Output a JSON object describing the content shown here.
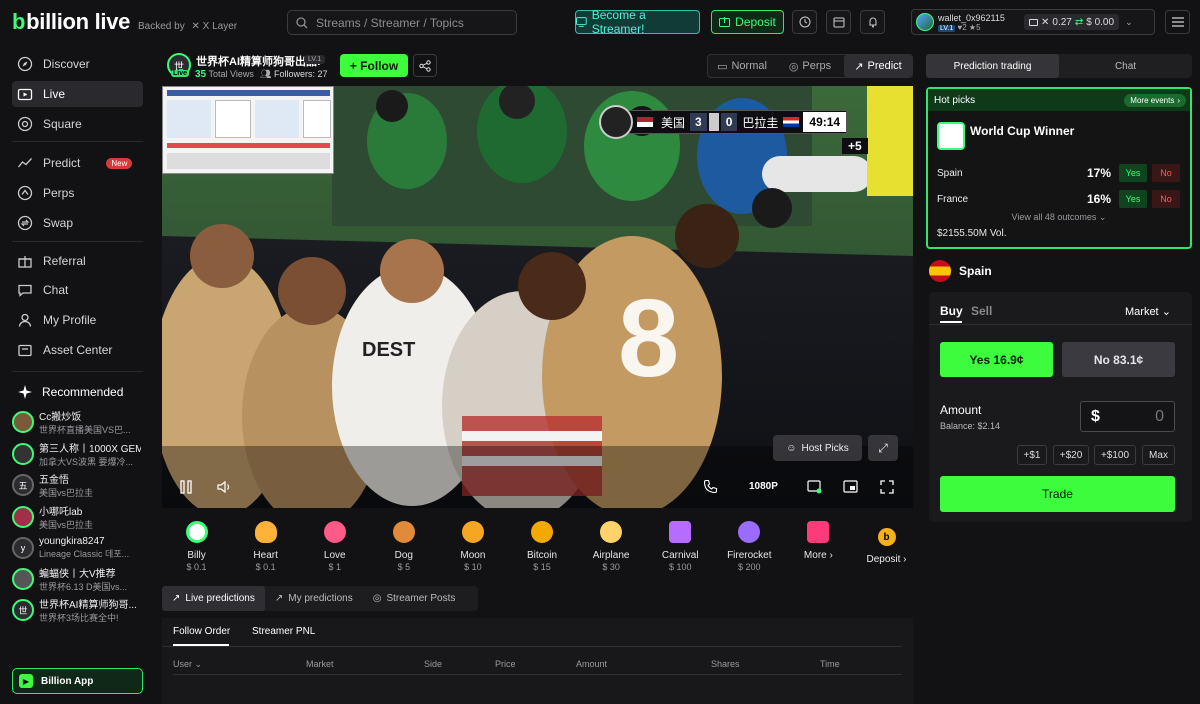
{
  "header": {
    "logo": "billion live",
    "backed_by": "Backed by",
    "backed_partner": "X Layer",
    "search_placeholder": "Streams / Streamer / Topics",
    "become_streamer": "Become a Streamer!",
    "deposit": "Deposit",
    "wallet": {
      "name": "wallet_0x962115",
      "level": "LV.1",
      "stat_a": "2",
      "stat_b": "5",
      "balance_a": "0.27",
      "balance_b": "$ 0.00"
    }
  },
  "sidebar": {
    "nav": [
      {
        "label": "Discover",
        "icon": "compass-icon"
      },
      {
        "label": "Live",
        "icon": "tv-icon"
      },
      {
        "label": "Square",
        "icon": "square-icon"
      },
      {
        "label": "Predict",
        "icon": "predict-icon",
        "badge": "New"
      },
      {
        "label": "Perps",
        "icon": "perps-icon"
      },
      {
        "label": "Swap",
        "icon": "swap-icon"
      },
      {
        "label": "Referral",
        "icon": "gift-icon"
      },
      {
        "label": "Chat",
        "icon": "chat-icon"
      },
      {
        "label": "My Profile",
        "icon": "user-icon"
      },
      {
        "label": "Asset Center",
        "icon": "wallet-icon"
      }
    ],
    "recommended_title": "Recommended",
    "recommended": [
      {
        "avatar": "",
        "name": "Cc搬炒饭",
        "desc": "世界杯直播美国VS巴..."
      },
      {
        "avatar": "",
        "name": "第三人称丨1000X GEM",
        "desc": "加拿大VS波黑 要爆冷..."
      },
      {
        "avatar": "五",
        "name": "五金悟",
        "desc": "美国vs巴拉圭"
      },
      {
        "avatar": "",
        "name": "小哪吒lab",
        "desc": "美国vs巴拉圭"
      },
      {
        "avatar": "y",
        "name": "youngkira8247",
        "desc": "Lineage Classic 데포..."
      },
      {
        "avatar": "",
        "name": "蝙蝠侠丨大V推荐",
        "desc": "世界杯6.13 D美国vs..."
      },
      {
        "avatar": "世",
        "name": "世界杯AI精算师狗哥...",
        "desc": "世界杯3场比赛全中!"
      }
    ],
    "app_button": "Billion App"
  },
  "stream": {
    "avatar": "世",
    "live_badge": "Live",
    "title": "世界杯AI精算师狗哥出品!",
    "level": "LV.1",
    "views_count": "35",
    "views_label": "Total Views",
    "followers": "Followers: 27",
    "follow_button": "+ Follow",
    "modes": [
      "Normal",
      "Perps",
      "Predict"
    ],
    "scoreboard": {
      "home": "美国",
      "home_score": "3",
      "away_score": "0",
      "away": "巴拉圭",
      "clock": "49:14",
      "added": "+5"
    },
    "host_picks": "Host Picks",
    "quality": "1080P"
  },
  "gifts": [
    {
      "name": "Billy",
      "price": "$ 0.1",
      "color": "#ffffff"
    },
    {
      "name": "Heart",
      "price": "$ 0.1",
      "color": "#ffb23a"
    },
    {
      "name": "Love",
      "price": "$ 1",
      "color": "#ff5a8a"
    },
    {
      "name": "Dog",
      "price": "$ 5",
      "color": "#e08a3a"
    },
    {
      "name": "Moon",
      "price": "$ 10",
      "color": "#f5a623"
    },
    {
      "name": "Bitcoin",
      "price": "$ 15",
      "color": "#f2a900"
    },
    {
      "name": "Airplane",
      "price": "$ 30",
      "color": "#ffd36a"
    },
    {
      "name": "Carnival",
      "price": "$ 100",
      "color": "#b66cff"
    },
    {
      "name": "Firerocket",
      "price": "$ 200",
      "color": "#9b6bff"
    },
    {
      "name": "More",
      "price": "",
      "color": "#ff3a7a"
    }
  ],
  "deposit_gift": "Deposit",
  "bottom_tabs": [
    "Live predictions",
    "My predictions",
    "Streamer Posts"
  ],
  "sub_tabs": [
    "Follow Order",
    "Streamer PNL"
  ],
  "table_headers": [
    "User",
    "Market",
    "Side",
    "Price",
    "Amount",
    "Shares",
    "Time"
  ],
  "right": {
    "tabs": [
      "Prediction trading",
      "Chat"
    ],
    "hot_picks": "Hot picks",
    "more_events": "More events",
    "market_title": "World Cup Winner",
    "outcomes": [
      {
        "name": "Spain",
        "pct": "17%"
      },
      {
        "name": "France",
        "pct": "16%"
      }
    ],
    "yes": "Yes",
    "no": "No",
    "view_all": "View all 48 outcomes",
    "volume": "$2155.50M Vol.",
    "selected": "Spain",
    "buy": "Buy",
    "sell": "Sell",
    "order_type": "Market",
    "yes_price": "Yes 16.9¢",
    "no_price": "No 83.1¢",
    "amount_label": "Amount",
    "balance": "Balance: $2.14",
    "amount_currency": "$",
    "amount_value": "0",
    "quick": [
      "+$1",
      "+$20",
      "+$100",
      "Max"
    ],
    "trade": "Trade"
  }
}
